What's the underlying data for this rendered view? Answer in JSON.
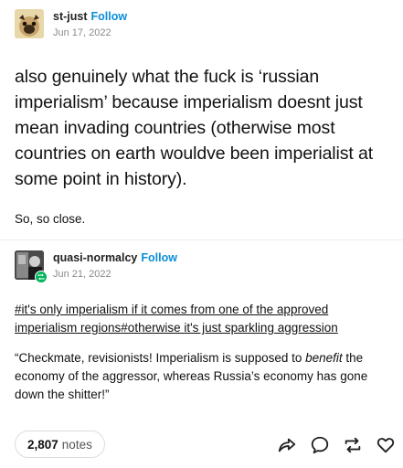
{
  "post1": {
    "username": "st-just",
    "follow_label": "Follow",
    "date": "Jun 17, 2022",
    "body": "also genuinely what the fuck is ‘russian imperialism’ because imperialism doesnt just mean invading countries (otherwise most countries on earth wouldve been imperialist at some point in history).",
    "reply": "So, so close."
  },
  "post2": {
    "username": "quasi-normalcy",
    "follow_label": "Follow",
    "date": "Jun 21, 2022",
    "tags": [
      "#it's only imperialism if it comes from one of the approved imperialism regions",
      "#otherwise it's just sparkling aggression"
    ],
    "quote_part1": "“Checkmate, revisionists! Imperialism is supposed to ",
    "quote_emphasis": "benefit",
    "quote_part2": " the economy of the aggressor, whereas Russia’s economy has gone down the shitter!”"
  },
  "footer": {
    "notes_count": "2,807",
    "notes_label": "notes",
    "icons": [
      "share-icon",
      "reply-icon",
      "reblog-icon",
      "like-icon"
    ]
  },
  "colors": {
    "follow": "#0a8fd8",
    "reblog_badge": "#00b45a"
  }
}
